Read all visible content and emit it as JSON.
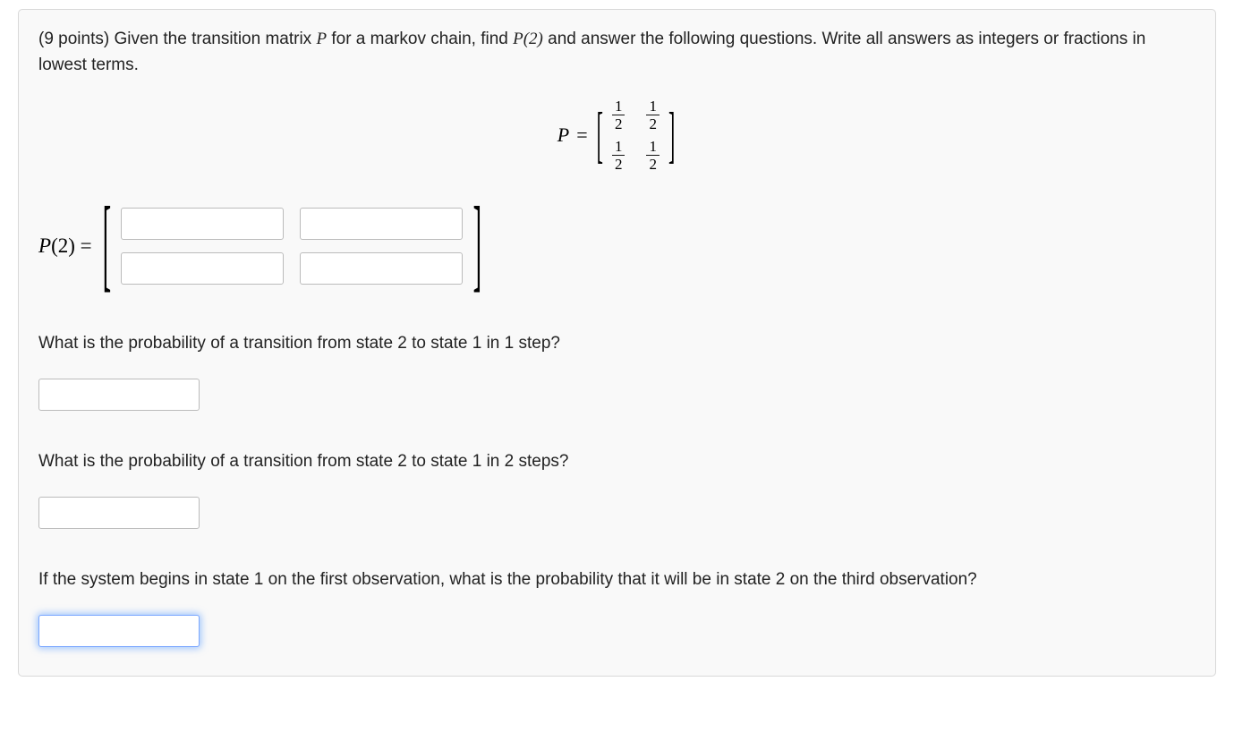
{
  "question": {
    "points_prefix": "(9 points) ",
    "prompt_before_P": "Given the transition matrix ",
    "var_P": "P",
    "prompt_mid": " for a markov chain, find ",
    "var_P2": "P(2)",
    "prompt_after": " and answer the following questions. Write all answers as integers or fractions in lowest terms."
  },
  "matrix_eq": {
    "lhs": "P",
    "equals": "=",
    "cells": [
      {
        "num": "1",
        "den": "2"
      },
      {
        "num": "1",
        "den": "2"
      },
      {
        "num": "1",
        "den": "2"
      },
      {
        "num": "1",
        "den": "2"
      }
    ]
  },
  "p2_label": {
    "text": "P(2) ="
  },
  "q1": "What is the probability of a transition from state 2 to state 1 in 1 step?",
  "q2": "What is the probability of a transition from state 2 to state 1 in 2 steps?",
  "q3": "If the system begins in state 1 on the first observation, what is the probability that it will be in state 2 on the third observation?",
  "inputs": {
    "m11": "",
    "m12": "",
    "m21": "",
    "m22": "",
    "a1": "",
    "a2": "",
    "a3": ""
  }
}
